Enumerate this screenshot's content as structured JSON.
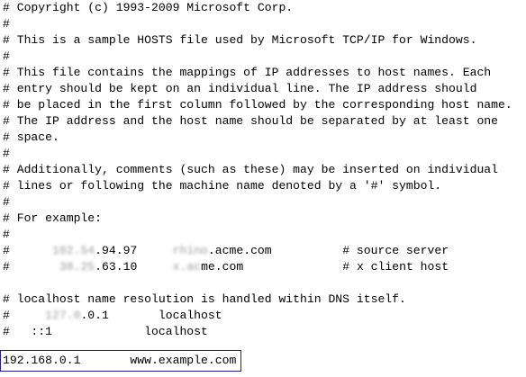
{
  "lines": {
    "l1": "# Copyright (c) 1993-2009 Microsoft Corp.",
    "l2": "#",
    "l3": "# This is a sample HOSTS file used by Microsoft TCP/IP for Windows.",
    "l4": "#",
    "l5": "# This file contains the mappings of IP addresses to host names. Each",
    "l6": "# entry should be kept on an individual line. The IP address should",
    "l7": "# be placed in the first column followed by the corresponding host name.",
    "l8": "# The IP address and the host name should be separated by at least one",
    "l9": "# space.",
    "l10": "#",
    "l11": "# Additionally, comments (such as these) may be inserted on individual",
    "l12": "# lines or following the machine name denoted by a '#' symbol.",
    "l13": "#",
    "l14": "# For example:",
    "l15": "#",
    "l18": "# localhost name resolution is handled within DNS itself.",
    "l20": "#   ::1             localhost",
    "edit": "192.168.0.1       www.example.com"
  },
  "example1": {
    "prefix": "#      ",
    "ip_hidden": "102.54",
    "ip_visible": ".94.97",
    "gap": "     ",
    "host_hidden": "rhino",
    "host_visible": ".acme.com",
    "comment": "          # source server"
  },
  "example2": {
    "prefix": "#       ",
    "ip_hidden": "38.25",
    "ip_visible": ".63.10",
    "gap": "     ",
    "host_hidden": "x.ac",
    "host_visible": "me.com",
    "comment": "              # x client host"
  },
  "localhost_v4": {
    "prefix": "#     ",
    "ip_hidden": "127.0",
    "ip_visible": ".0.1",
    "rest": "       localhost"
  }
}
